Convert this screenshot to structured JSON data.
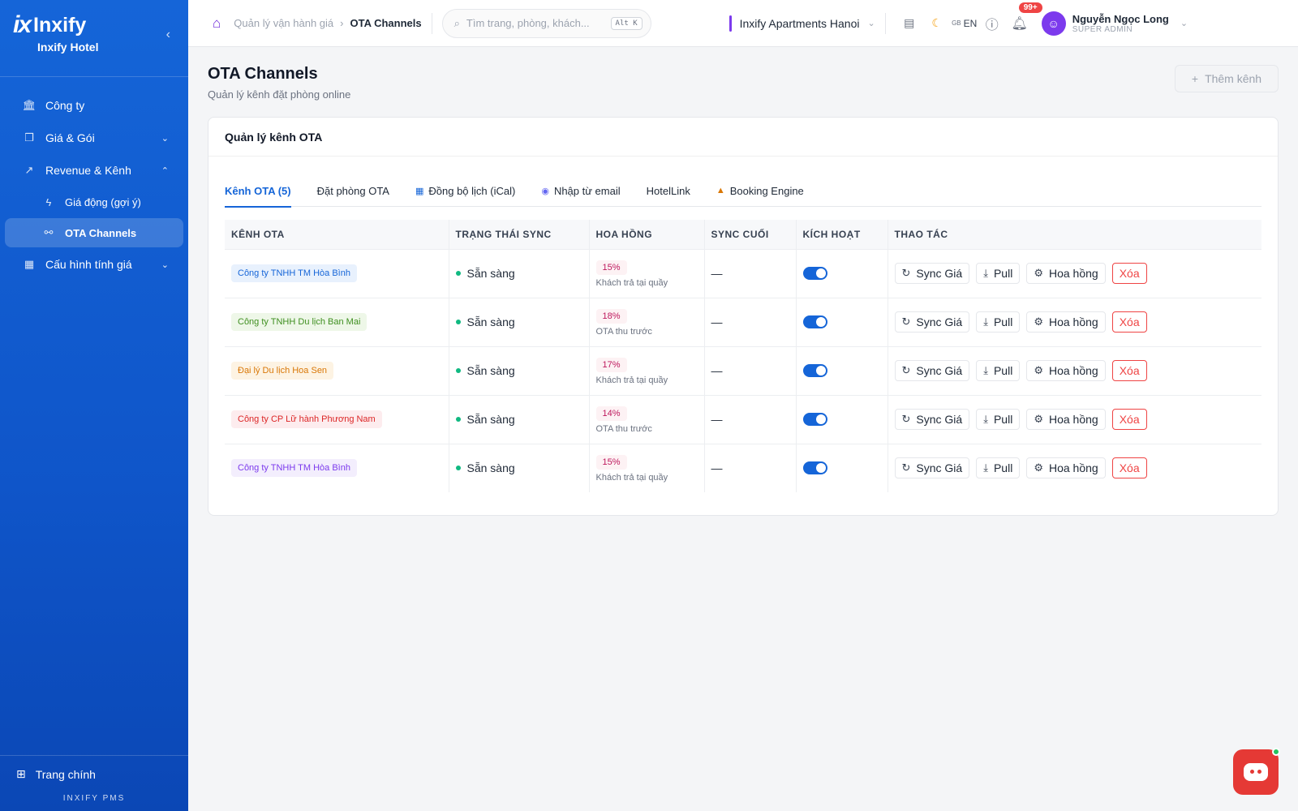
{
  "sidebar": {
    "brand": "Inxify",
    "brand_mark": "ix",
    "subtitle": "Inxify Hotel",
    "items": [
      {
        "label": "Công ty",
        "icon": "bank-icon"
      },
      {
        "label": "Giá & Gói",
        "icon": "tag-icon"
      },
      {
        "label": "Revenue & Kênh",
        "icon": "chart-line-icon"
      },
      {
        "label": "Giá động (gợi ý)",
        "icon": "lightning-icon"
      },
      {
        "label": "OTA Channels",
        "icon": "link-icon"
      },
      {
        "label": "Cấu hình tính giá",
        "icon": "calculator-icon"
      }
    ],
    "footer_home": "Trang chính",
    "footer_brand": "INXIFY PMS"
  },
  "header": {
    "breadcrumb_parent": "Quản lý vận hành giá",
    "breadcrumb_current": "OTA Channels",
    "search_placeholder": "Tìm trang, phòng, khách...",
    "search_shortcut": "Alt K",
    "property": "Inxify Apartments Hanoi",
    "lang_flag": "GB",
    "lang": "EN",
    "notification_count": "99+",
    "user_name": "Nguyễn Ngọc Long",
    "user_role": "SUPER ADMIN"
  },
  "page": {
    "title": "OTA Channels",
    "subtitle": "Quản lý kênh đặt phòng online",
    "add_button": "Thêm kênh"
  },
  "card": {
    "title": "Quản lý kênh OTA",
    "tabs": [
      {
        "label": "Kênh OTA (5)"
      },
      {
        "label": "Đặt phòng OTA"
      },
      {
        "label": "Đồng bộ lịch (iCal)"
      },
      {
        "label": "Nhập từ email"
      },
      {
        "label": "HotelLink"
      },
      {
        "label": "Booking Engine"
      }
    ],
    "columns": [
      "KÊNH OTA",
      "TRẠNG THÁI SYNC",
      "HOA HỒNG",
      "SYNC CUỐI",
      "KÍCH HOẠT",
      "THAO TÁC"
    ],
    "rows": [
      {
        "channel": "Công ty TNHH TM Hòa Bình",
        "chip_bg": "#e8f1fd",
        "chip_fg": "#1565d8",
        "status": "Sẵn sàng",
        "commission": "15%",
        "payment": "Khách trả tại quầy",
        "last_sync": "—"
      },
      {
        "channel": "Công ty TNHH Du lịch Ban Mai",
        "chip_bg": "#eef7e8",
        "chip_fg": "#3f8f20",
        "status": "Sẵn sàng",
        "commission": "18%",
        "payment": "OTA thu trước",
        "last_sync": "—"
      },
      {
        "channel": "Đại lý Du lịch Hoa Sen",
        "chip_bg": "#fdf3e3",
        "chip_fg": "#d97706",
        "status": "Sẵn sàng",
        "commission": "17%",
        "payment": "Khách trả tại quầy",
        "last_sync": "—"
      },
      {
        "channel": "Công ty CP Lữ hành Phương Nam",
        "chip_bg": "#fdecee",
        "chip_fg": "#dc2626",
        "status": "Sẵn sàng",
        "commission": "14%",
        "payment": "OTA thu trước",
        "last_sync": "—"
      },
      {
        "channel": "Công ty TNHH TM Hòa Bình",
        "chip_bg": "#f3eefd",
        "chip_fg": "#7c3aed",
        "status": "Sẵn sàng",
        "commission": "15%",
        "payment": "Khách trả tại quầy",
        "last_sync": "—"
      }
    ],
    "actions": {
      "sync": "Sync Giá",
      "pull": "Pull",
      "commission": "Hoa hồng",
      "delete": "Xóa"
    }
  }
}
